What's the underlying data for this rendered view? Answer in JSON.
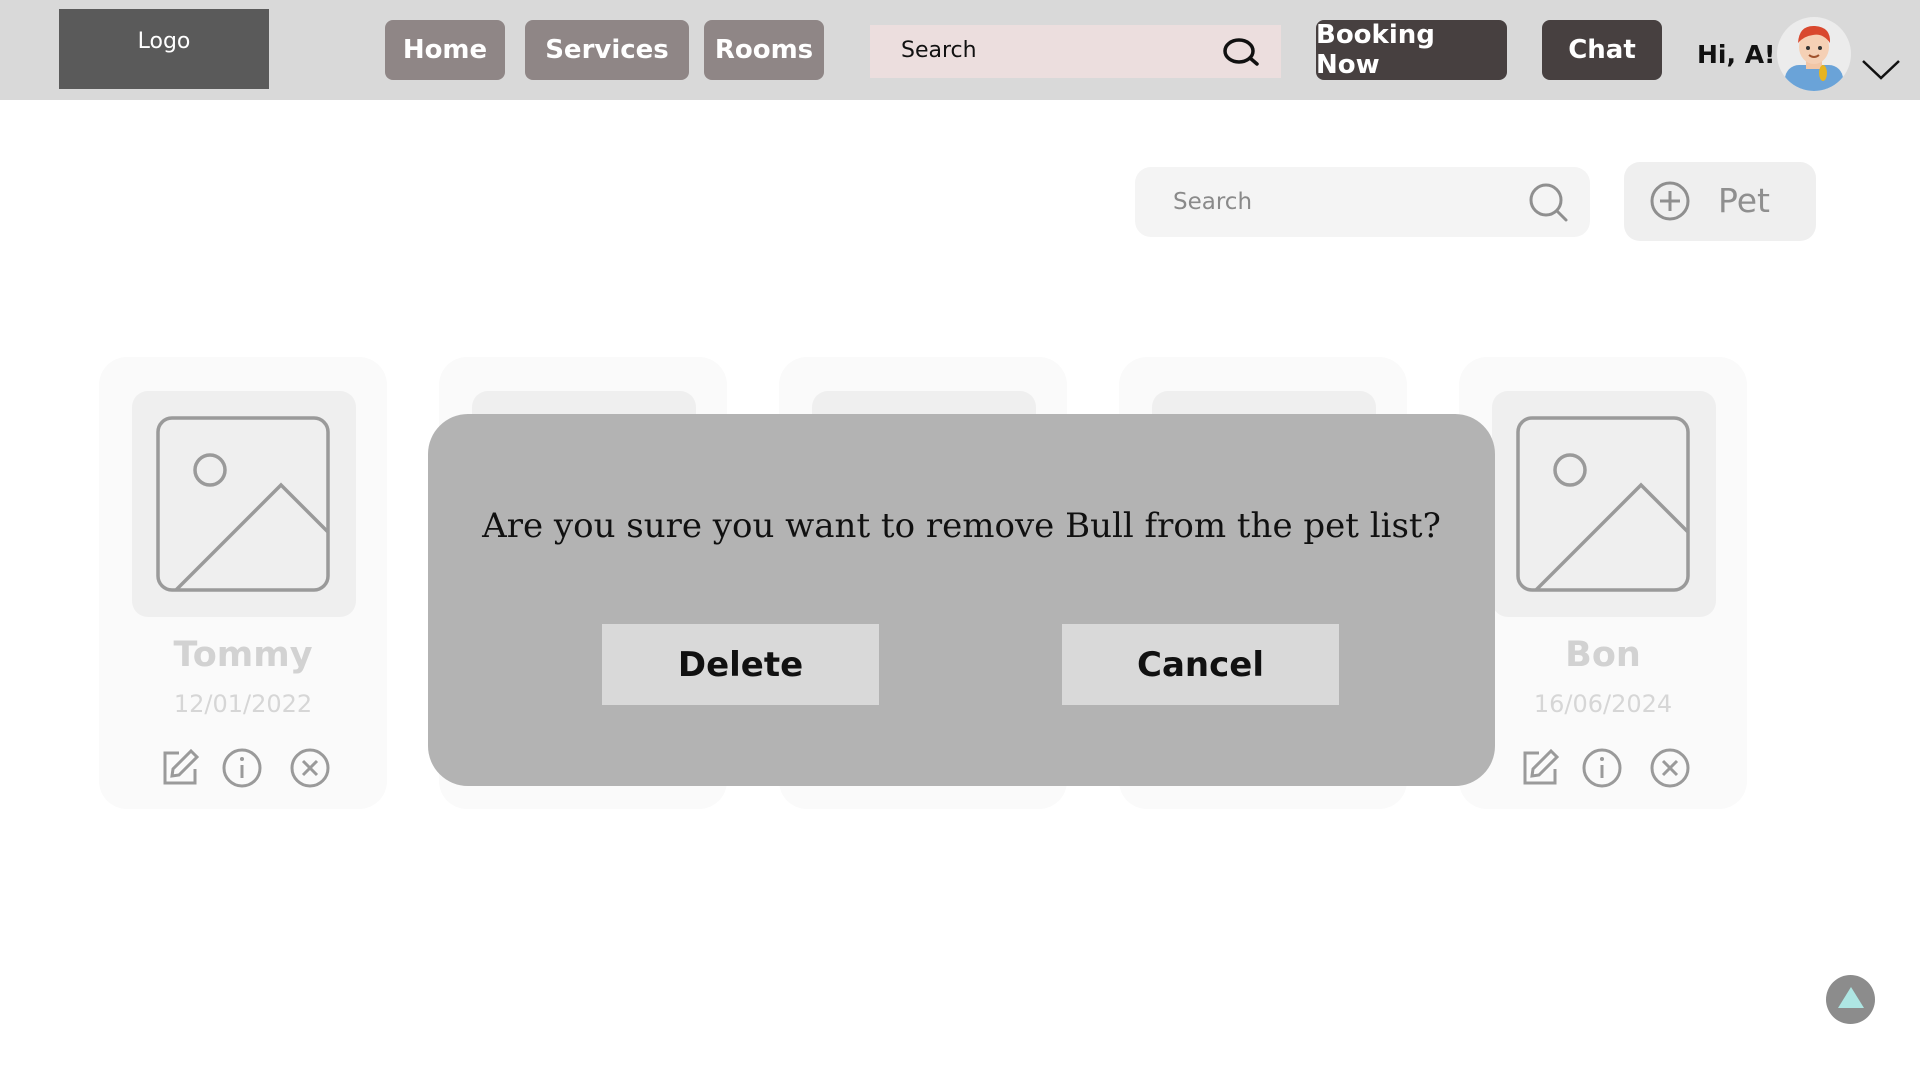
{
  "header": {
    "logo": "Logo",
    "nav": [
      "Home",
      "Services",
      "Rooms"
    ],
    "search_label": "Search",
    "booking_label": "Booking Now",
    "chat_label": "Chat",
    "greeting": "Hi, A!"
  },
  "toolbar": {
    "search_placeholder": "Search",
    "add_pet_label": "Pet"
  },
  "pets": [
    {
      "name": "Tommy",
      "date": "12/01/2022"
    },
    {
      "name": "",
      "date": ""
    },
    {
      "name": "",
      "date": ""
    },
    {
      "name": "",
      "date": ""
    },
    {
      "name": "Bon",
      "date": "16/06/2024"
    }
  ],
  "modal": {
    "message": "Are you sure you want to remove Bull from the pet list?",
    "delete_label": "Delete",
    "cancel_label": "Cancel"
  },
  "colors": {
    "header_bg": "#d9d9d9",
    "nav_button": "#8f8686",
    "dark_button": "#474040",
    "modal_bg": "#b3b3b3",
    "scroll_arrow": "#aee6e3"
  }
}
